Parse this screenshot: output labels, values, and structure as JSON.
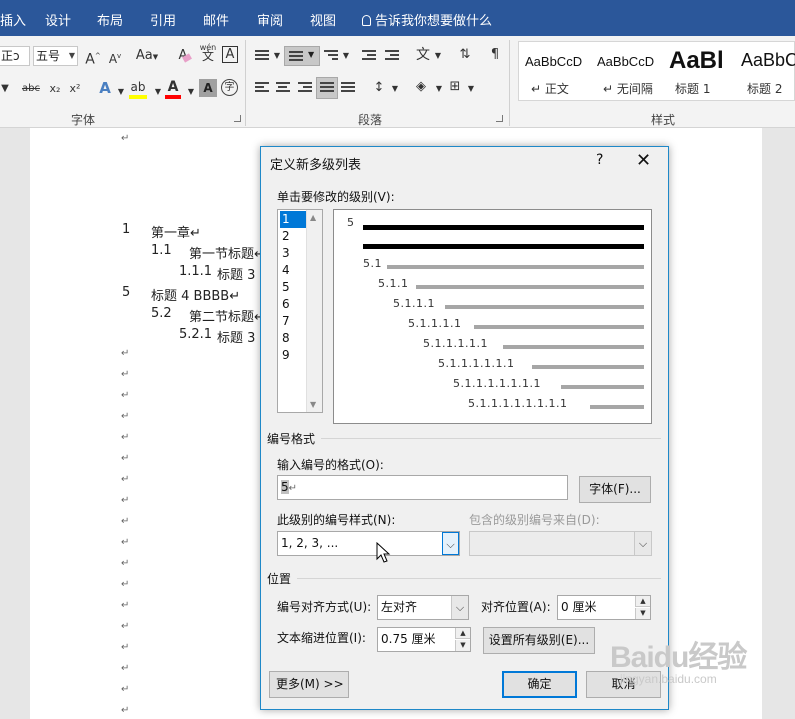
{
  "ribbon_tabs": {
    "insert": "插入",
    "design": "设计",
    "layout": "布局",
    "references": "引用",
    "mailings": "邮件",
    "review": "审阅",
    "view": "视图",
    "tell_me": "告诉我你想要做什么"
  },
  "ribbon": {
    "font_name_fragment": "正ɔ",
    "font_size": "五号",
    "grow_font": "A",
    "shrink_font": "A",
    "change_case": "Aa",
    "clear_format": "A",
    "phonetic": "wén",
    "phonetic_char": "文",
    "char_border": "A",
    "strikethrough": "abc",
    "subscript": "x₂",
    "superscript": "x²",
    "text_effect": "A",
    "highlight": "ab",
    "font_color": "A",
    "char_shading": "A",
    "enclose_char": "字",
    "font_group_label": "字体",
    "paragraph_group_label": "段落",
    "styles_group_label": "样式",
    "styles": [
      {
        "sample": "AaBbCcD",
        "name": "正文"
      },
      {
        "sample": "AaBbCcD",
        "name": "无间隔"
      },
      {
        "sample": "AaBl",
        "name": "标题 1"
      },
      {
        "sample": "AaBbC",
        "name": "标题 2"
      }
    ],
    "colors": {
      "tab_bar": "#2b579a",
      "highlight_yellow": "#ffff00",
      "font_red": "#ff0000"
    }
  },
  "document": {
    "paragraph_mark": "↵",
    "lines": [
      {
        "num": "1",
        "text": "第一章↵"
      },
      {
        "num": "1.1",
        "text": "第一节标题↵"
      },
      {
        "num": "1.1.1",
        "text": "标题 3"
      },
      {
        "num": "5",
        "text": "标题 4 BBBB↵"
      },
      {
        "num": "5.2",
        "text": "第二节标题↵"
      },
      {
        "num": "5.2.1",
        "text": "标题 3"
      }
    ]
  },
  "dialog": {
    "title": "定义新多级列表",
    "help": "?",
    "close": "✕",
    "level_prompt": "单击要修改的级别(V):",
    "levels": [
      "1",
      "2",
      "3",
      "4",
      "5",
      "6",
      "7",
      "8",
      "9"
    ],
    "selected_level": "1",
    "preview_numbers": [
      "5",
      "5.1",
      "5.1.1",
      "5.1.1.1",
      "5.1.1.1.1",
      "5.1.1.1.1.1",
      "5.1.1.1.1.1.1",
      "5.1.1.1.1.1.1.1",
      "5.1.1.1.1.1.1.1.1"
    ],
    "number_format_section": "编号格式",
    "enter_format_label": "输入编号的格式(O):",
    "format_value": "5",
    "font_button": "字体(F)...",
    "number_style_label": "此级别的编号样式(N):",
    "number_style_value": "1, 2, 3, ...",
    "include_level_label": "包含的级别编号来自(D):",
    "include_level_value": "",
    "position_section": "位置",
    "alignment_label": "编号对齐方式(U):",
    "alignment_value": "左对齐",
    "aligned_at_label": "对齐位置(A):",
    "aligned_at_value": "0 厘米",
    "indent_label": "文本缩进位置(I):",
    "indent_value": "0.75 厘米",
    "set_all_button": "设置所有级别(E)...",
    "more_button": "更多(M) >>",
    "ok_button": "确定",
    "cancel_button": "取消"
  },
  "watermark": {
    "brand": "Baidu经验",
    "url": "jingyan.baidu.com"
  }
}
